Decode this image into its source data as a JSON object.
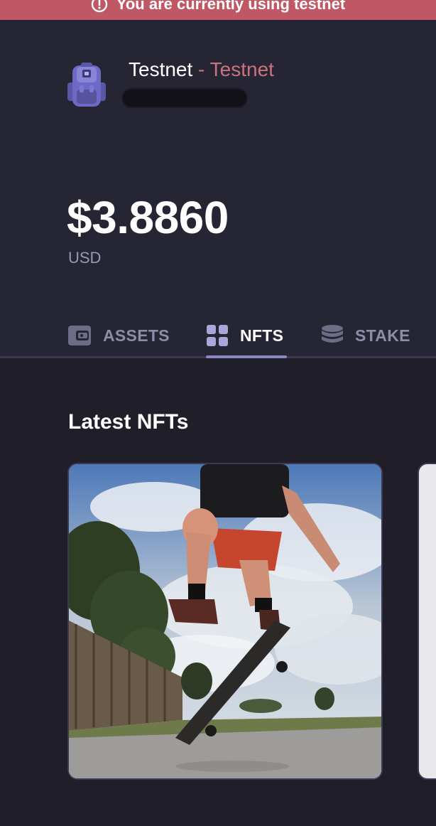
{
  "banner": {
    "text": "You are currently using testnet",
    "icon": "alert-circle-icon",
    "color": "#c05764"
  },
  "account": {
    "name": "Testnet",
    "separator": " - ",
    "network": "Testnet",
    "avatar_icon": "backpack-icon"
  },
  "wallet": {
    "balance": "$3.8860",
    "currency": "USD"
  },
  "tabs": [
    {
      "label": "ASSETS",
      "icon": "wallet-icon",
      "active": false
    },
    {
      "label": "NFTS",
      "icon": "grid-icon",
      "active": true
    },
    {
      "label": "STAKE",
      "icon": "database-stack-icon",
      "active": false
    }
  ],
  "main": {
    "section_title": "Latest NFTs"
  },
  "colors": {
    "background": "#1f1e29",
    "header_background": "#262534",
    "accent": "#8b86c5",
    "network_text": "#c9737e"
  }
}
